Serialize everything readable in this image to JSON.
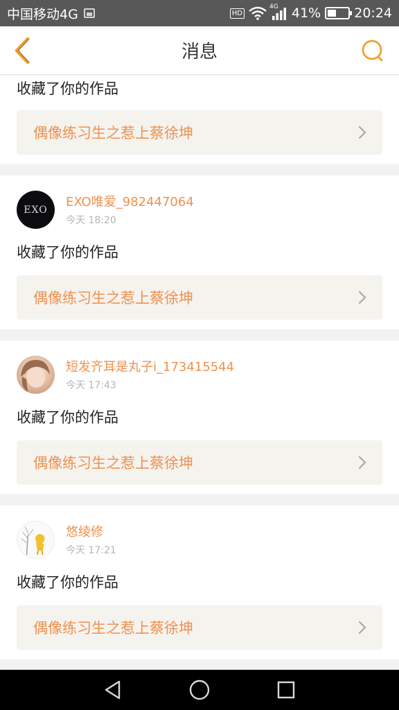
{
  "status_bar": {
    "carrier": "中国移动4G",
    "network": "4G",
    "battery_percent": "41%",
    "battery_level": 0.41,
    "time": "20:24"
  },
  "header": {
    "title": "消息",
    "back_icon": "chevron-left-icon",
    "search_icon": "search-icon",
    "accent_color": "#f0a030"
  },
  "messages": [
    {
      "action": "收藏了你的作品",
      "work_title": "偶像练习生之惹上蔡徐坤"
    },
    {
      "username": "EXO唯爱_982447064",
      "time": "今天 18:20",
      "avatar_text": "EXO",
      "action": "收藏了你的作品",
      "work_title": "偶像练习生之惹上蔡徐坤"
    },
    {
      "username": "短发齐耳是丸子i_173415544",
      "time": "今天 17:43",
      "action": "收藏了你的作品",
      "work_title": "偶像练习生之惹上蔡徐坤"
    },
    {
      "username": "悠绫修",
      "time": "今天 17:21",
      "action": "收藏了你的作品",
      "work_title": "偶像练习生之惹上蔡徐坤"
    }
  ],
  "colors": {
    "username": "#f0904f",
    "work_title": "#f0904f",
    "work_box_bg": "#f4f3ee"
  },
  "system_nav": {
    "back_icon": "triangle-back-icon",
    "home_icon": "circle-home-icon",
    "recents_icon": "square-recents-icon"
  }
}
